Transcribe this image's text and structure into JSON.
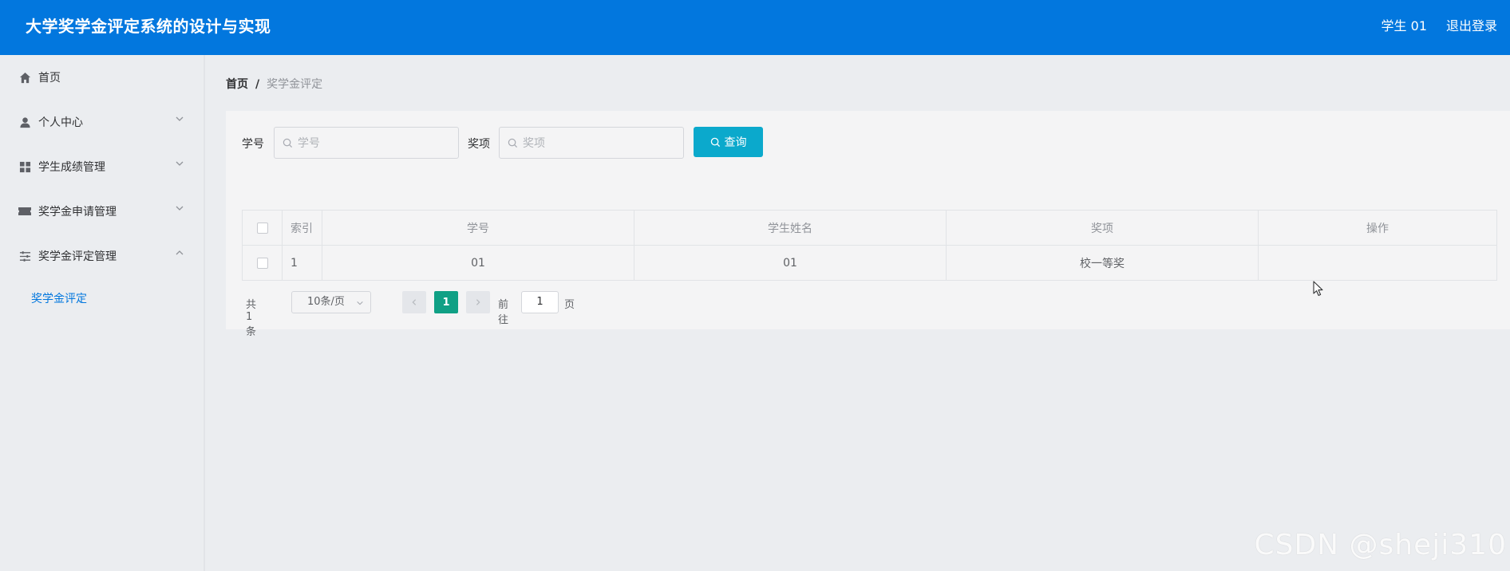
{
  "header": {
    "title": "大学奖学金评定系统的设计与实现",
    "user": "学生 01",
    "logout": "退出登录"
  },
  "sidebar": {
    "items": [
      {
        "label": "首页",
        "icon": "home-icon"
      },
      {
        "label": "个人中心",
        "icon": "user-icon"
      },
      {
        "label": "学生成绩管理",
        "icon": "grid-icon"
      },
      {
        "label": "奖学金申请管理",
        "icon": "ticket-icon"
      },
      {
        "label": "奖学金评定管理",
        "icon": "sliders-icon"
      }
    ],
    "subitem": "奖学金评定"
  },
  "breadcrumb": {
    "home": "首页",
    "separator": "/",
    "current": "奖学金评定"
  },
  "search": {
    "student_id_label": "学号",
    "student_id_placeholder": "学号",
    "award_label": "奖项",
    "award_placeholder": "奖项",
    "query_button": "查询"
  },
  "table": {
    "columns": [
      "索引",
      "学号",
      "学生姓名",
      "奖项",
      "操作"
    ],
    "rows": [
      {
        "index": "1",
        "student_id": "01",
        "name": "01",
        "award": "校一等奖",
        "action": ""
      }
    ]
  },
  "pagination": {
    "total": "共 1 条",
    "page_size": "10条/页",
    "current_page": "1",
    "goto_label": "前往",
    "goto_value": "1",
    "page_label": "页"
  },
  "watermark": "CSDN @sheji310",
  "colors": {
    "header_bg": "#0277de",
    "query_button": "#0ba9cc",
    "active_page": "#10a085",
    "active_link": "#0277de"
  }
}
